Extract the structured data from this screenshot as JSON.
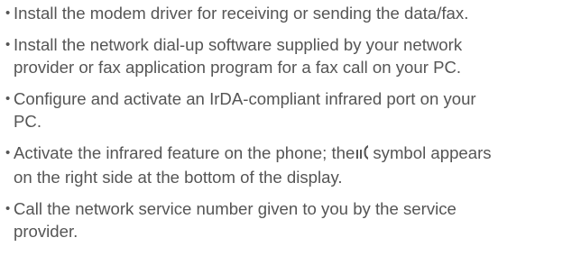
{
  "items": [
    {
      "bullet": "•",
      "text": "Install the modem driver for receiving or sending the data/fax."
    },
    {
      "bullet": "•",
      "text": "Install the network dial-up software supplied by your network\nprovider or fax application program for a fax call on your PC."
    },
    {
      "bullet": "•",
      "text": "Configure and activate an IrDA-compliant infrared port on your\nPC."
    },
    {
      "bullet": "•",
      "text_before": "Activate the infrared feature on the phone; the",
      "icon": "infrared-icon",
      "text_after": "symbol appears\non the right side at the bottom of the display."
    },
    {
      "bullet": "•",
      "text": "Call the network service number given to you by the service\nprovider."
    }
  ]
}
